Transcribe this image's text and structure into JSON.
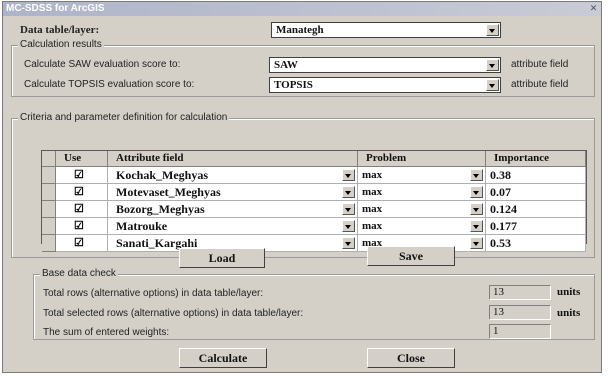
{
  "window": {
    "title": "MC-SDSS for ArcGIS"
  },
  "data_table": {
    "label": "Data table/layer:",
    "value": "Manategh"
  },
  "calc_results": {
    "group_title": "Calculation results",
    "saw_label": "Calculate SAW evaluation score to:",
    "saw_value": "SAW",
    "topsis_label": "Calculate TOPSIS evaluation score to:",
    "topsis_value": "TOPSIS",
    "attr_field_text": "attribute field"
  },
  "criteria": {
    "group_title": "Criteria and parameter definition for calculation",
    "headers": {
      "use": "Use",
      "attribute": "Attribute field",
      "problem": "Problem",
      "importance": "Importance"
    },
    "rows": [
      {
        "use": "☑",
        "attribute": "Kochak_Meghyas",
        "problem": "max",
        "importance": "0.38"
      },
      {
        "use": "☑",
        "attribute": "Motevaset_Meghyas",
        "problem": "max",
        "importance": "0.07"
      },
      {
        "use": "☑",
        "attribute": "Bozorg_Meghyas",
        "problem": "max",
        "importance": "0.124"
      },
      {
        "use": "☑",
        "attribute": "Matrouke",
        "problem": "max",
        "importance": "0.177"
      },
      {
        "use": "☑",
        "attribute": "Sanati_Kargahi",
        "problem": "max",
        "importance": "0.53"
      }
    ]
  },
  "buttons": {
    "load": "Load",
    "save": "Save",
    "calculate": "Calculate",
    "close": "Close"
  },
  "base_check": {
    "group_title": "Base data check",
    "total_rows_label": "Total rows (alternative options) in data table/layer:",
    "total_rows_value": "13",
    "selected_rows_label": "Total selected rows (alternative options) in data table/layer:",
    "selected_rows_value": "13",
    "weights_label": "The sum of entered weights:",
    "weights_value": "1",
    "units": "units"
  },
  "icons": {
    "close": "close-icon",
    "dropdown": "chevron-down-icon",
    "check": "checkbox-checked-icon"
  }
}
